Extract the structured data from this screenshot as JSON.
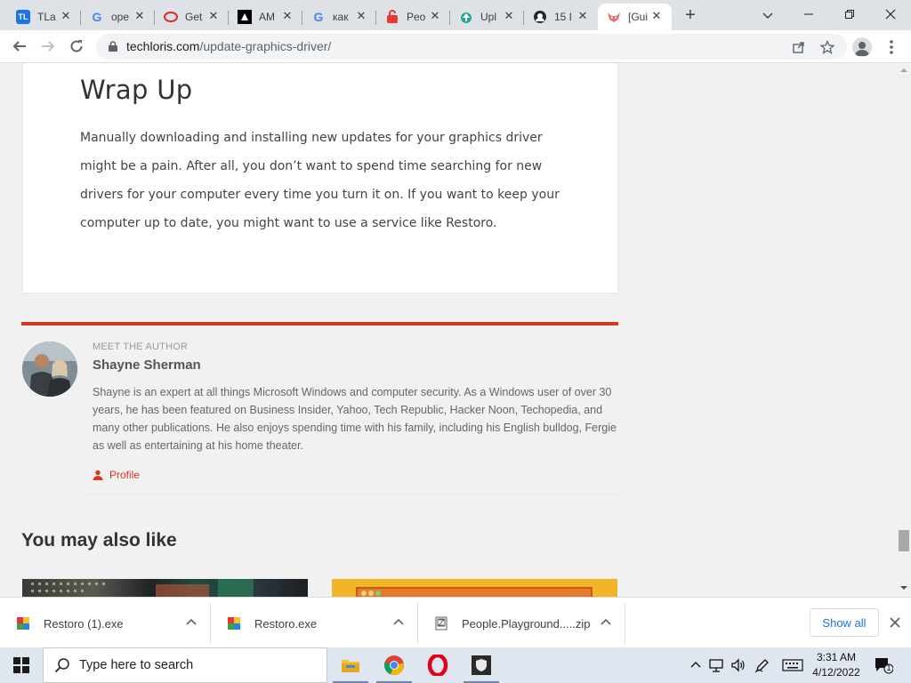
{
  "browser": {
    "tabs": [
      {
        "title": "TLa",
        "favicon": "tl-icon",
        "color": "#1a73e8",
        "active": false
      },
      {
        "title": "ope",
        "favicon": "google-icon",
        "color": "#4285f4",
        "active": false
      },
      {
        "title": "Get",
        "favicon": "opera-ring-icon",
        "color": "#d32f2f",
        "active": false
      },
      {
        "title": "AM",
        "favicon": "amd-icon",
        "color": "#000000",
        "active": false
      },
      {
        "title": "как",
        "favicon": "google-icon",
        "color": "#4285f4",
        "active": false
      },
      {
        "title": "Peo",
        "favicon": "red-lock-icon",
        "color": "#e53935",
        "active": false
      },
      {
        "title": "Upl",
        "favicon": "upload-icon",
        "color": "#26a69a",
        "active": false
      },
      {
        "title": "15 I",
        "favicon": "github-icon",
        "color": "#24292e",
        "active": false
      },
      {
        "title": "[Gui",
        "favicon": "fox-icon",
        "color": "#e57373",
        "active": true
      }
    ],
    "url_domain": "techloris.com",
    "url_path": "/update-graphics-driver/"
  },
  "article": {
    "section_title": "Wrap Up",
    "paragraph": "Manually downloading and installing new updates for your graphics driver might be a pain. After all, you don’t want to spend time searching for new drivers for your computer every time you turn it on. If you want to keep your computer up to date, you might want to use a service like Restoro."
  },
  "author": {
    "label": "MEET THE AUTHOR",
    "name": "Shayne Sherman",
    "bio": "Shayne is an expert at all things Microsoft Windows and computer security. As a Windows user of over 30 years, he has been featured on Business Insider, Yahoo, Tech Republic, Hacker Noon, Techopedia, and many other publications. He also enjoys spending time with his family, including his English bulldog, Fergie as well as entertaining at his home theater.",
    "profile_link": "Profile",
    "accent_color": "#d3391f"
  },
  "related": {
    "heading": "You may also like"
  },
  "downloads": {
    "items": [
      {
        "name": "Restoro (1).exe",
        "icon": "restoro-icon"
      },
      {
        "name": "Restoro.exe",
        "icon": "restoro-icon"
      },
      {
        "name": "People.Playground.....zip",
        "icon": "zip-icon"
      }
    ],
    "show_all": "Show all"
  },
  "taskbar": {
    "search_placeholder": "Type here to search",
    "apps": [
      "file-explorer-icon",
      "chrome-icon",
      "opera-icon",
      "shield-app-icon"
    ],
    "time": "3:31 AM",
    "date": "4/12/2022",
    "notification_count": "1"
  }
}
